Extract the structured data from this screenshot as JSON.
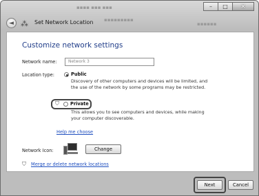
{
  "window": {
    "title": "Set Network Location",
    "controls": {
      "minimize": "–",
      "maximize": "□",
      "close": "✕"
    }
  },
  "page": {
    "heading": "Customize network settings",
    "network_name_label": "Network name:",
    "network_name_value": "Network 3",
    "location_type_label": "Location type:",
    "public_label": "Public",
    "public_desc_1": "Discovery of other computers and devices will be limited, and",
    "public_desc_2": "the use of the network by some programs may be restricted.",
    "private_label": "Private",
    "private_desc_1": "This allows you to see computers and devices, while making",
    "private_desc_2": "your computer discoverable.",
    "help_link": "Help me choose",
    "network_icon_label": "Network Icon:",
    "change_button": "Change",
    "merge_link": "Merge or delete network locations"
  },
  "footer": {
    "next_button": "Next",
    "cancel_button": "Cancel"
  }
}
